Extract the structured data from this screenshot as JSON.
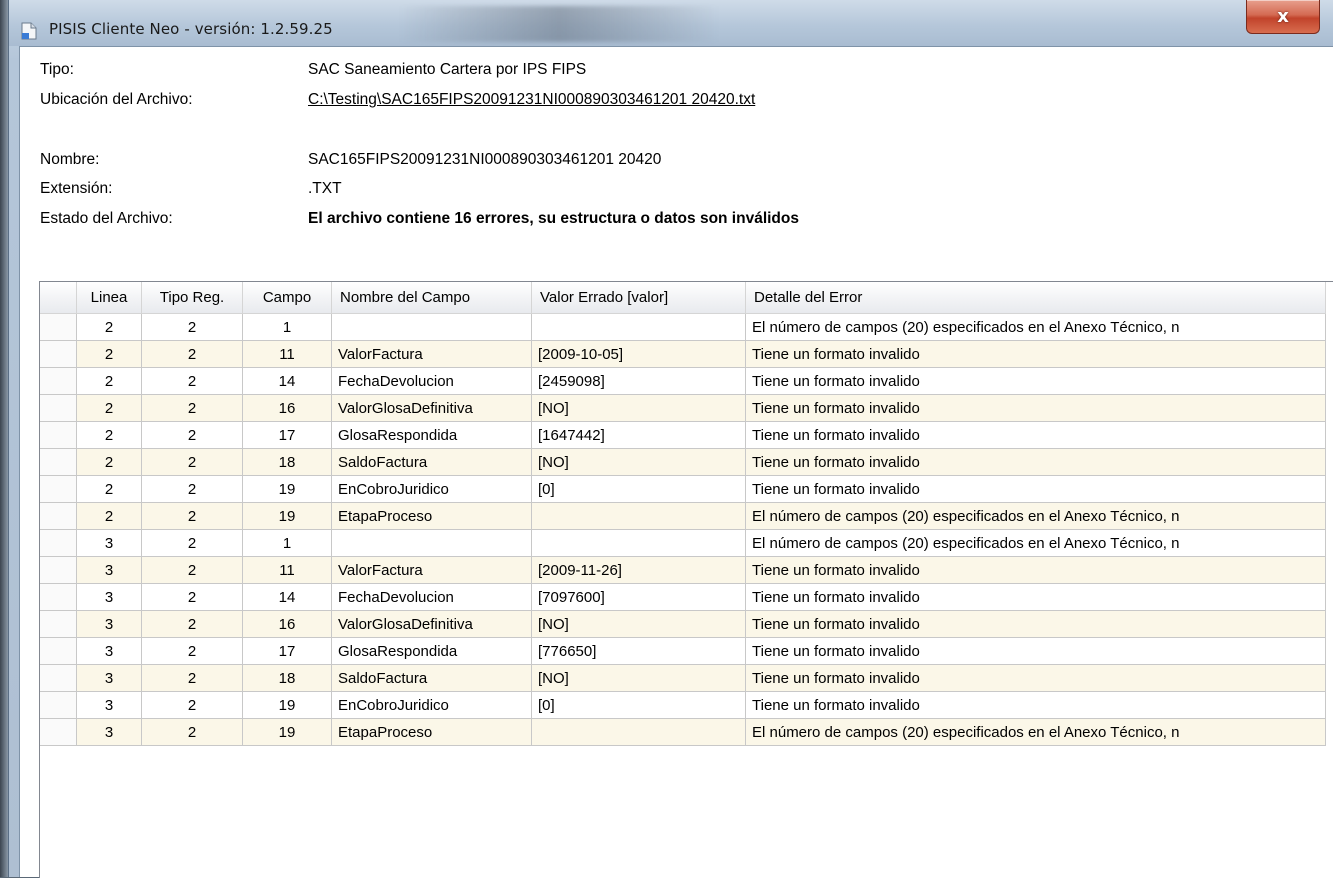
{
  "window": {
    "title": "PISIS Cliente Neo - versión: 1.2.59.25",
    "close_label": "x"
  },
  "info": {
    "tipo": {
      "label": "Tipo:",
      "value": "SAC Saneamiento Cartera por IPS FIPS"
    },
    "ubicacion": {
      "label": "Ubicación del Archivo:",
      "value": "C:\\Testing\\SAC165FIPS20091231NI000890303461201 20420.txt"
    },
    "nombre": {
      "label": "Nombre:",
      "value": "SAC165FIPS20091231NI000890303461201 20420"
    },
    "extension": {
      "label": "Extensión:",
      "value": ".TXT"
    },
    "estado": {
      "label": "Estado del Archivo:",
      "value": "El archivo contiene 16 errores, su estructura o datos son inválidos"
    }
  },
  "table": {
    "columns": [
      "Linea",
      "Tipo Reg.",
      "Campo",
      "Nombre del Campo",
      "Valor Errado [valor]",
      "Detalle del Error"
    ],
    "rows": [
      [
        "2",
        "2",
        "1",
        "",
        "",
        "El número de campos (20) especificados en el Anexo Técnico, n"
      ],
      [
        "2",
        "2",
        "11",
        "ValorFactura",
        "[2009-10-05]",
        "Tiene un formato invalido"
      ],
      [
        "2",
        "2",
        "14",
        "FechaDevolucion",
        "[2459098]",
        "Tiene un formato invalido"
      ],
      [
        "2",
        "2",
        "16",
        "ValorGlosaDefinitiva",
        "[NO]",
        "Tiene un formato invalido"
      ],
      [
        "2",
        "2",
        "17",
        "GlosaRespondida",
        "[1647442]",
        "Tiene un formato invalido"
      ],
      [
        "2",
        "2",
        "18",
        "SaldoFactura",
        "[NO]",
        "Tiene un formato invalido"
      ],
      [
        "2",
        "2",
        "19",
        "EnCobroJuridico",
        "[0]",
        "Tiene un formato invalido"
      ],
      [
        "2",
        "2",
        "19",
        "EtapaProceso",
        "",
        "El número de campos (20) especificados en el Anexo Técnico, n"
      ],
      [
        "3",
        "2",
        "1",
        "",
        "",
        "El número de campos (20) especificados en el Anexo Técnico, n"
      ],
      [
        "3",
        "2",
        "11",
        "ValorFactura",
        "[2009-11-26]",
        "Tiene un formato invalido"
      ],
      [
        "3",
        "2",
        "14",
        "FechaDevolucion",
        "[7097600]",
        "Tiene un formato invalido"
      ],
      [
        "3",
        "2",
        "16",
        "ValorGlosaDefinitiva",
        "[NO]",
        "Tiene un formato invalido"
      ],
      [
        "3",
        "2",
        "17",
        "GlosaRespondida",
        "[776650]",
        "Tiene un formato invalido"
      ],
      [
        "3",
        "2",
        "18",
        "SaldoFactura",
        "[NO]",
        "Tiene un formato invalido"
      ],
      [
        "3",
        "2",
        "19",
        "EnCobroJuridico",
        "[0]",
        "Tiene un formato invalido"
      ],
      [
        "3",
        "2",
        "19",
        "EtapaProceso",
        "",
        "El número de campos (20) especificados en el Anexo Técnico, n"
      ]
    ]
  }
}
